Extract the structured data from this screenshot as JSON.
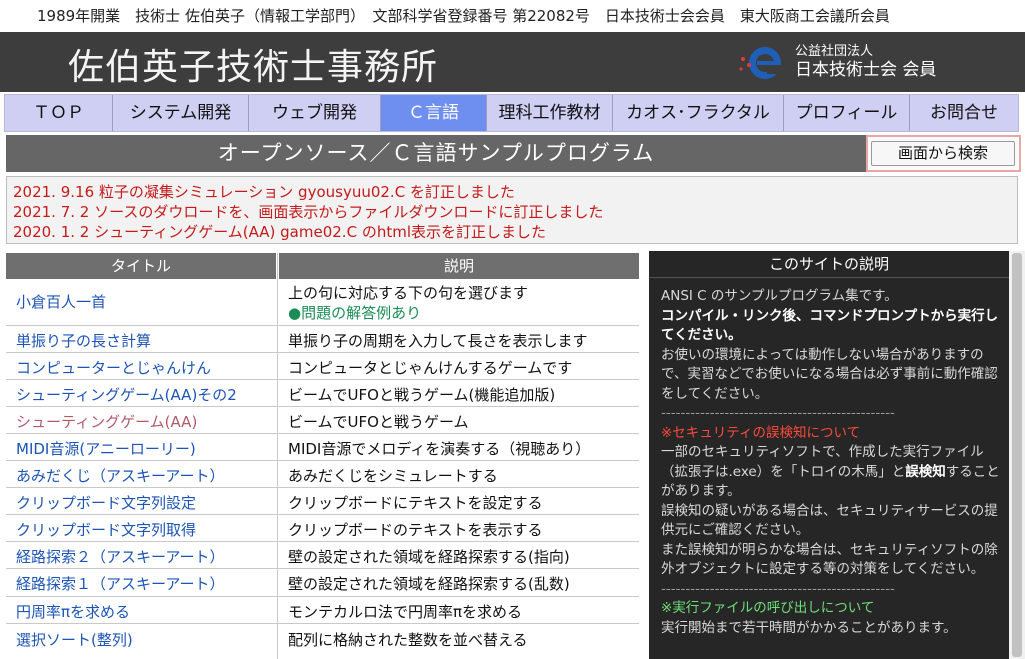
{
  "topline": "1989年開業　技術士 佐伯英子（情報工学部門）　文部科学省登録番号 第22082号　日本技術士会会員　東大阪商工会議所会員",
  "header": {
    "title": "佐伯英子技術士事務所",
    "badge_line1": "公益社団法人",
    "badge_line2": "日本技術士会 会員"
  },
  "nav": {
    "items": [
      "ＴＯＰ",
      "システム開発",
      "ウェブ開発",
      "Ｃ言語",
      "理科工作教材",
      "カオス･フラクタル",
      "プロフィール",
      "お問合せ"
    ],
    "active_index": 3
  },
  "section": {
    "title": "オープンソース／Ｃ言語サンプルプログラム",
    "search_button": "画面から検索"
  },
  "news": [
    "2021. 9.16 粒子の凝集シミュレーション gyousyuu02.C を訂正しました",
    "2021. 7. 2 ソースのダウロードを、画面表示からファイルダウンロードに訂正しました",
    "2020. 1. 2 シューティングゲーム(AA) game02.C のhtml表示を訂正しました"
  ],
  "table": {
    "headers": [
      "タイトル",
      "説明"
    ],
    "rows": [
      {
        "title": "小倉百人一首",
        "desc": "上の句に対応する下の句を選びます",
        "extra": "●問題の解答例あり"
      },
      {
        "title": "単振り子の長さ計算",
        "desc": "単振り子の周期を入力して長さを表示します"
      },
      {
        "title": "コンピューターとじゃんけん",
        "desc": "コンピュータとじゃんけんするゲームです"
      },
      {
        "title": "シューティングゲーム(AA)その2",
        "desc": "ビームでUFOと戦うゲーム(機能追加版)"
      },
      {
        "title": "シューティングゲーム(AA)",
        "desc": "ビームでUFOと戦うゲーム",
        "visited": true
      },
      {
        "title": "MIDI音源(アニーローリー)",
        "desc": "MIDI音源でメロディを演奏する（視聴あり）"
      },
      {
        "title": "あみだくじ（アスキーアート）",
        "desc": "あみだくじをシミュレートする"
      },
      {
        "title": "クリップボード文字列設定",
        "desc": "クリップボードにテキストを設定する"
      },
      {
        "title": "クリップボード文字列取得",
        "desc": "クリップボードのテキストを表示する"
      },
      {
        "title": "経路探索２（アスキーアート）",
        "desc": "壁の設定された領域を経路探索する(指向)"
      },
      {
        "title": "経路探索１（アスキーアート）",
        "desc": "壁の設定された領域を経路探索する(乱数)"
      },
      {
        "title": "円周率πを求める",
        "desc": "モンテカルロ法で円周率πを求める"
      },
      {
        "title": "選択ソート(整列)",
        "desc": "配列に格納された整数を並べ替える"
      }
    ]
  },
  "sidebar": {
    "title": "このサイトの説明",
    "intro": "ANSI C のサンプルプログラム集です。",
    "bold": "コンパイル・リンク後、コマンドプロンプトから実行してください。",
    "note": "お使いの環境によっては動作しない場合がありますので、実習などでお使いになる場合は必ず事前に動作確認をしてください。",
    "separator": "------------------------------------------------",
    "security_title": "※セキュリティの誤検知について",
    "security_text1": "一部のセキュリティソフトで、作成した実行ファイル（拡張子は.exe）を「トロイの木馬」と",
    "security_bold": "誤検知",
    "security_text1b": "することがあります。",
    "security_text2": "誤検知の疑いがある場合は、セキュリティサービスの提供元にご確認ください。",
    "security_text3": "また誤検知が明らかな場合は、セキュリティソフトの除外オブジェクトに設定する等の対策をしてください。",
    "exec_title": "※実行ファイルの呼び出しについて",
    "exec_text": "実行開始まで若干時間がかかることがあります。"
  }
}
